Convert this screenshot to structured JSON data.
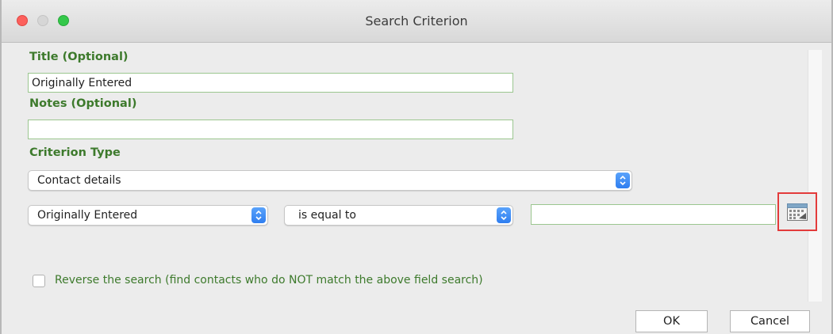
{
  "window": {
    "title": "Search Criterion"
  },
  "form": {
    "title_label": "Title (Optional)",
    "title_value": "Originally Entered",
    "notes_label": "Notes (Optional)",
    "notes_value": "",
    "criterion_type_label": "Criterion Type",
    "criterion_type_value": "Contact details",
    "field_value": "Originally Entered",
    "operator_value": "is equal to",
    "date_value": "",
    "reverse_label": "Reverse the search (find contacts who do NOT match the above field search)",
    "reverse_checked": false
  },
  "buttons": {
    "ok": "OK",
    "cancel": "Cancel"
  },
  "icons": {
    "date_picker": "calendar-icon",
    "select_arrows": "up-down-chevron-icon"
  },
  "colors": {
    "label_green": "#3d7a2c",
    "field_border_green": "#9bc68f",
    "highlight_red": "#e33b3b",
    "select_accent_blue": "#2f7ef0"
  }
}
